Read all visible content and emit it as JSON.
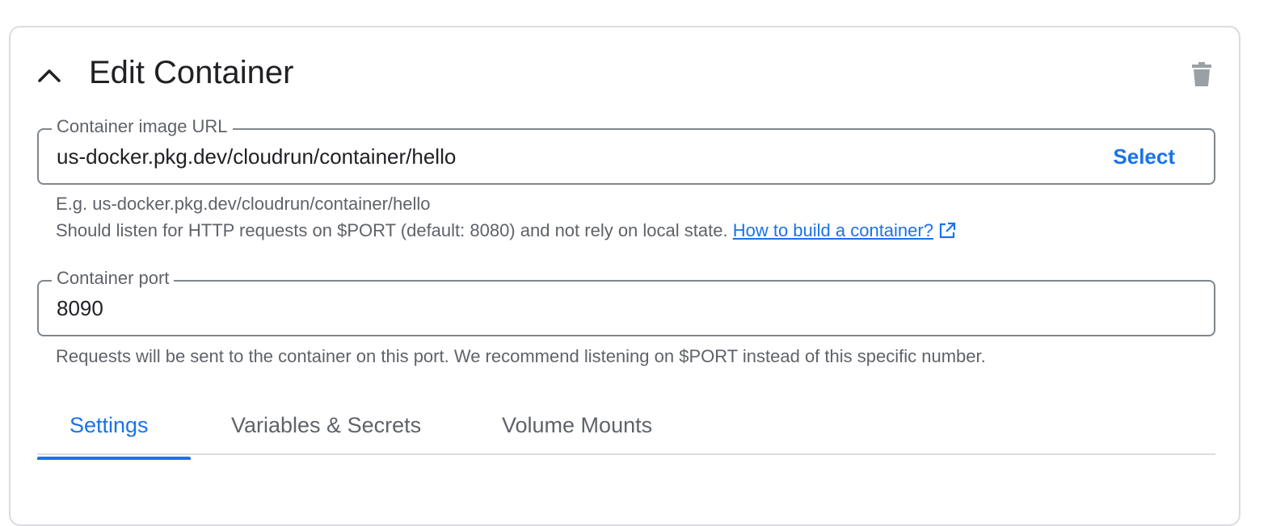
{
  "header": {
    "title": "Edit Container",
    "collapse_icon": "chevron-up-icon",
    "delete_icon": "trash-icon"
  },
  "image_field": {
    "label": "Container image URL",
    "value": "us-docker.pkg.dev/cloudrun/container/hello",
    "select_label": "Select",
    "example": "E.g. us-docker.pkg.dev/cloudrun/container/hello",
    "hint": "Should listen for HTTP requests on $PORT (default: 8080) and not rely on local state.",
    "link_text": "How to build a container?",
    "link_icon": "open-in-new-icon"
  },
  "port_field": {
    "label": "Container port",
    "value": "8090",
    "hint": "Requests will be sent to the container on this port. We recommend listening on $PORT instead of this specific number."
  },
  "tabs": [
    {
      "label": "Settings",
      "active": true
    },
    {
      "label": "Variables & Secrets",
      "active": false
    },
    {
      "label": "Volume Mounts",
      "active": false
    }
  ],
  "colors": {
    "accent": "#1a73e8",
    "border": "#80868b",
    "muted_text": "#5f6368",
    "icon_gray": "#9aa0a6"
  }
}
